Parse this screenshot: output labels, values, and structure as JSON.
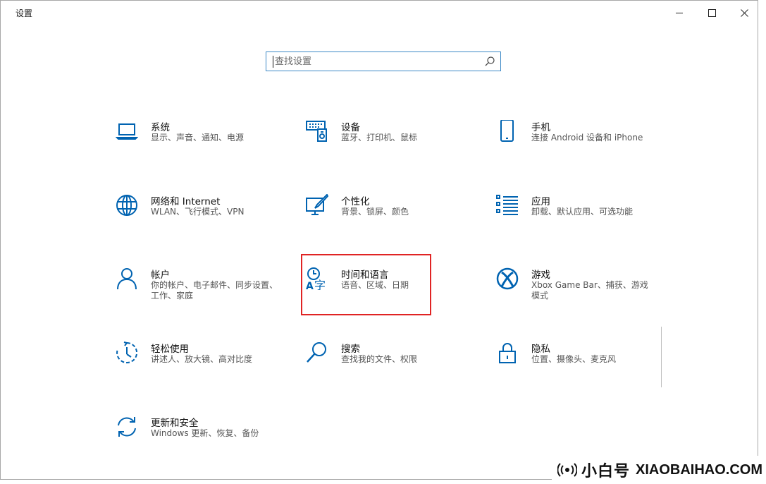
{
  "window": {
    "title": "设置",
    "controls": {
      "minimize": "minimize",
      "maximize": "maximize",
      "close": "close"
    }
  },
  "search": {
    "placeholder": "查找设置",
    "value": ""
  },
  "tiles": [
    {
      "name": "系统",
      "desc": "显示、声音、通知、电源",
      "icon": "laptop-icon"
    },
    {
      "name": "设备",
      "desc": "蓝牙、打印机、鼠标",
      "icon": "devices-icon"
    },
    {
      "name": "手机",
      "desc": "连接 Android 设备和 iPhone",
      "icon": "phone-icon"
    },
    {
      "name": "网络和 Internet",
      "desc": "WLAN、飞行模式、VPN",
      "icon": "globe-icon"
    },
    {
      "name": "个性化",
      "desc": "背景、锁屏、颜色",
      "icon": "paint-icon"
    },
    {
      "name": "应用",
      "desc": "卸载、默认应用、可选功能",
      "icon": "apps-list-icon"
    },
    {
      "name": "帐户",
      "desc": "你的帐户、电子邮件、同步设置、工作、家庭",
      "icon": "person-icon"
    },
    {
      "name": "时间和语言",
      "desc": "语音、区域、日期",
      "icon": "time-language-icon"
    },
    {
      "name": "游戏",
      "desc": "Xbox Game Bar、捕获、游戏模式",
      "icon": "xbox-icon"
    },
    {
      "name": "轻松使用",
      "desc": "讲述人、放大镜、高对比度",
      "icon": "ease-of-access-icon"
    },
    {
      "name": "搜索",
      "desc": "查找我的文件、权限",
      "icon": "magnifier-icon"
    },
    {
      "name": "隐私",
      "desc": "位置、摄像头、麦克风",
      "icon": "lock-icon"
    },
    {
      "name": "更新和安全",
      "desc": "Windows 更新、恢复、备份",
      "icon": "sync-icon"
    }
  ],
  "watermark": {
    "brand": "小白号",
    "site": "XIAOBAIHAO.COM"
  },
  "colors": {
    "accent": "#0063b1",
    "highlight": "#e02424",
    "search_border": "#3d89c6"
  }
}
